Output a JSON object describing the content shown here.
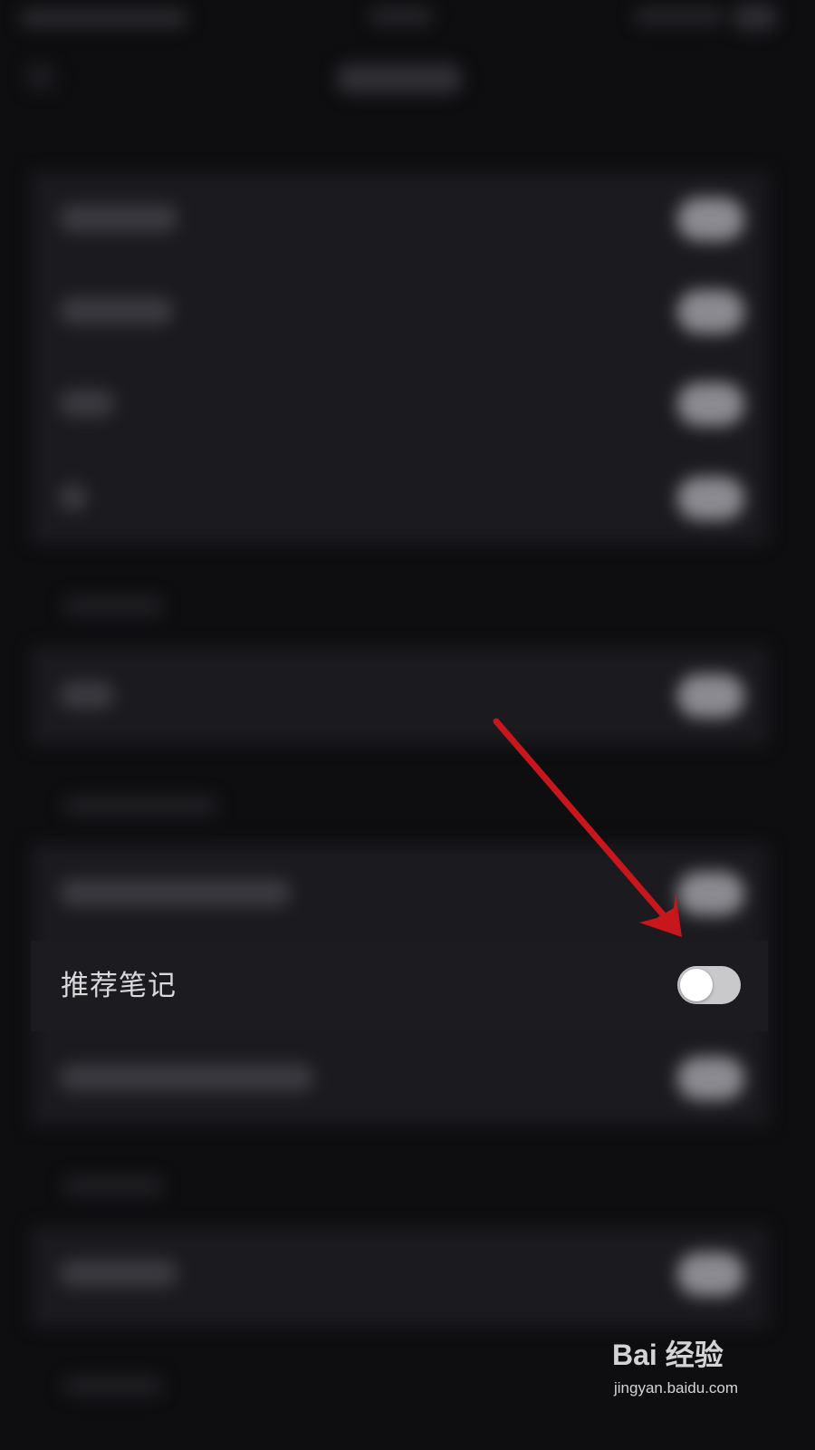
{
  "settings": {
    "recommend_notes": {
      "label": "推荐笔记",
      "toggle_on": false
    }
  },
  "colors": {
    "background": "#0e0e11",
    "row_background": "#1c1c20",
    "label": "#d9d9dc",
    "toggle_off_track": "#c9c9cc",
    "annotation_arrow": "#c8161d"
  },
  "icons": {
    "annotation": "red-arrow-icon"
  },
  "watermark": {
    "logo": "Bai 经验",
    "url": "jingyan.baidu.com"
  }
}
